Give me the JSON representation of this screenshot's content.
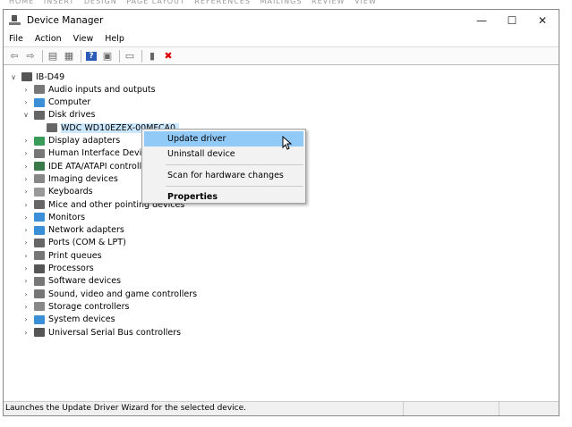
{
  "window": {
    "title": "Device Manager",
    "minimize": "—",
    "maximize": "☐",
    "close": "✕"
  },
  "menu": [
    "File",
    "Action",
    "View",
    "Help"
  ],
  "toolbar": [
    {
      "icon": "back-arrow-icon",
      "glyph": "⇦"
    },
    {
      "icon": "forward-arrow-icon",
      "glyph": "⇨"
    },
    {
      "icon": "show-hide-console-tree-icon",
      "glyph": "▤"
    },
    {
      "icon": "properties-icon",
      "glyph": "▦"
    },
    {
      "icon": "help-icon",
      "glyph": "?"
    },
    {
      "icon": "run-icon",
      "glyph": "▣"
    },
    {
      "icon": "scan-hardware-icon",
      "glyph": "▭"
    },
    {
      "icon": "add-driver-icon",
      "glyph": "▮"
    },
    {
      "icon": "uninstall-icon",
      "glyph": "✖"
    }
  ],
  "tree": {
    "root": "IB-D49",
    "items": [
      {
        "label": "Audio inputs and outputs",
        "color": "#777"
      },
      {
        "label": "Computer",
        "color": "#3b8fd6"
      },
      {
        "label": "Disk drives",
        "color": "#666",
        "expanded": true,
        "children": [
          "WDC WD10EZEX-00MFCA0"
        ]
      },
      {
        "label": "Display adapters",
        "color": "#3a9a5a"
      },
      {
        "label": "Human Interface Devices",
        "color": "#777"
      },
      {
        "label": "IDE ATA/ATAPI controllers",
        "color": "#3a7a4a"
      },
      {
        "label": "Imaging devices",
        "color": "#888"
      },
      {
        "label": "Keyboards",
        "color": "#999"
      },
      {
        "label": "Mice and other pointing devices",
        "color": "#666"
      },
      {
        "label": "Monitors",
        "color": "#3b8fd6"
      },
      {
        "label": "Network adapters",
        "color": "#3b8fd6"
      },
      {
        "label": "Ports (COM & LPT)",
        "color": "#666"
      },
      {
        "label": "Print queues",
        "color": "#777"
      },
      {
        "label": "Processors",
        "color": "#555"
      },
      {
        "label": "Software devices",
        "color": "#777"
      },
      {
        "label": "Sound, video and game controllers",
        "color": "#777"
      },
      {
        "label": "Storage controllers",
        "color": "#888"
      },
      {
        "label": "System devices",
        "color": "#3b8fd6"
      },
      {
        "label": "Universal Serial Bus controllers",
        "color": "#555"
      }
    ]
  },
  "context_menu": {
    "items": [
      "Update driver",
      "Uninstall device",
      "Scan for hardware changes",
      "Properties"
    ],
    "highlighted": "Update driver",
    "highlight_color": "#91c9f7"
  },
  "status": {
    "text": "Launches the Update Driver Wizard for the selected device."
  }
}
